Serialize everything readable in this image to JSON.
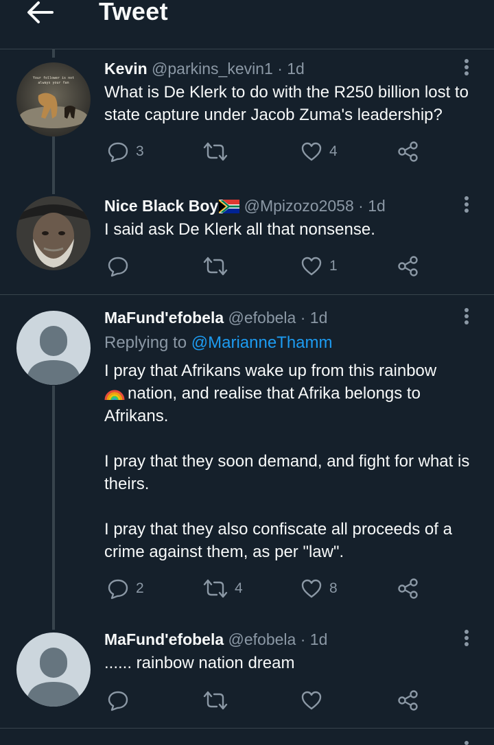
{
  "header": {
    "title": "Tweet"
  },
  "tweets": [
    {
      "name": "Kevin",
      "handle": "@parkins_kevin1",
      "dot": "·",
      "time": "1d",
      "avatar_text": "Your follower is not always your fan",
      "text": "What is De Klerk to do with the R250 billion lost to state capture under Jacob Zuma's leadership?",
      "replies": "3",
      "retweets": "",
      "likes": "4"
    },
    {
      "name": "Nice Black Boy",
      "handle": "@Mpizozo2058",
      "dot": "·",
      "time": "1d",
      "text": "I said ask De Klerk all that nonsense.",
      "replies": "",
      "retweets": "",
      "likes": "1"
    },
    {
      "name": "MaFund'efobela",
      "handle": "@efobela",
      "dot": "·",
      "time": "1d",
      "replying_prefix": "Replying to",
      "replying_to": "@MarianneThamm",
      "paragraphs": [
        "nation, and realise that Afrika belongs to Afrikans.",
        "I pray that they soon demand, and fight for what is theirs.",
        "I pray that they also confiscate all proceeds of a crime against them, as per \"law\"."
      ],
      "paragraph1_lead": "I pray that Afrikans wake up from this rainbow",
      "replies": "2",
      "retweets": "4",
      "likes": "8"
    },
    {
      "name": "MaFund'efobela",
      "handle": "@efobela",
      "dot": "·",
      "time": "1d",
      "text": "...... rainbow nation dream",
      "replies": "",
      "retweets": "",
      "likes": ""
    }
  ],
  "colors": {
    "background": "#15202b",
    "text": "#f7f9f9",
    "muted": "#8b98a5",
    "accent": "#1d9bf0",
    "divider": "#38444d"
  },
  "icons": {
    "back": "arrow-left-icon",
    "more": "more-vertical-icon",
    "reply": "reply-icon",
    "retweet": "retweet-icon",
    "like": "heart-icon",
    "share": "share-icon"
  }
}
